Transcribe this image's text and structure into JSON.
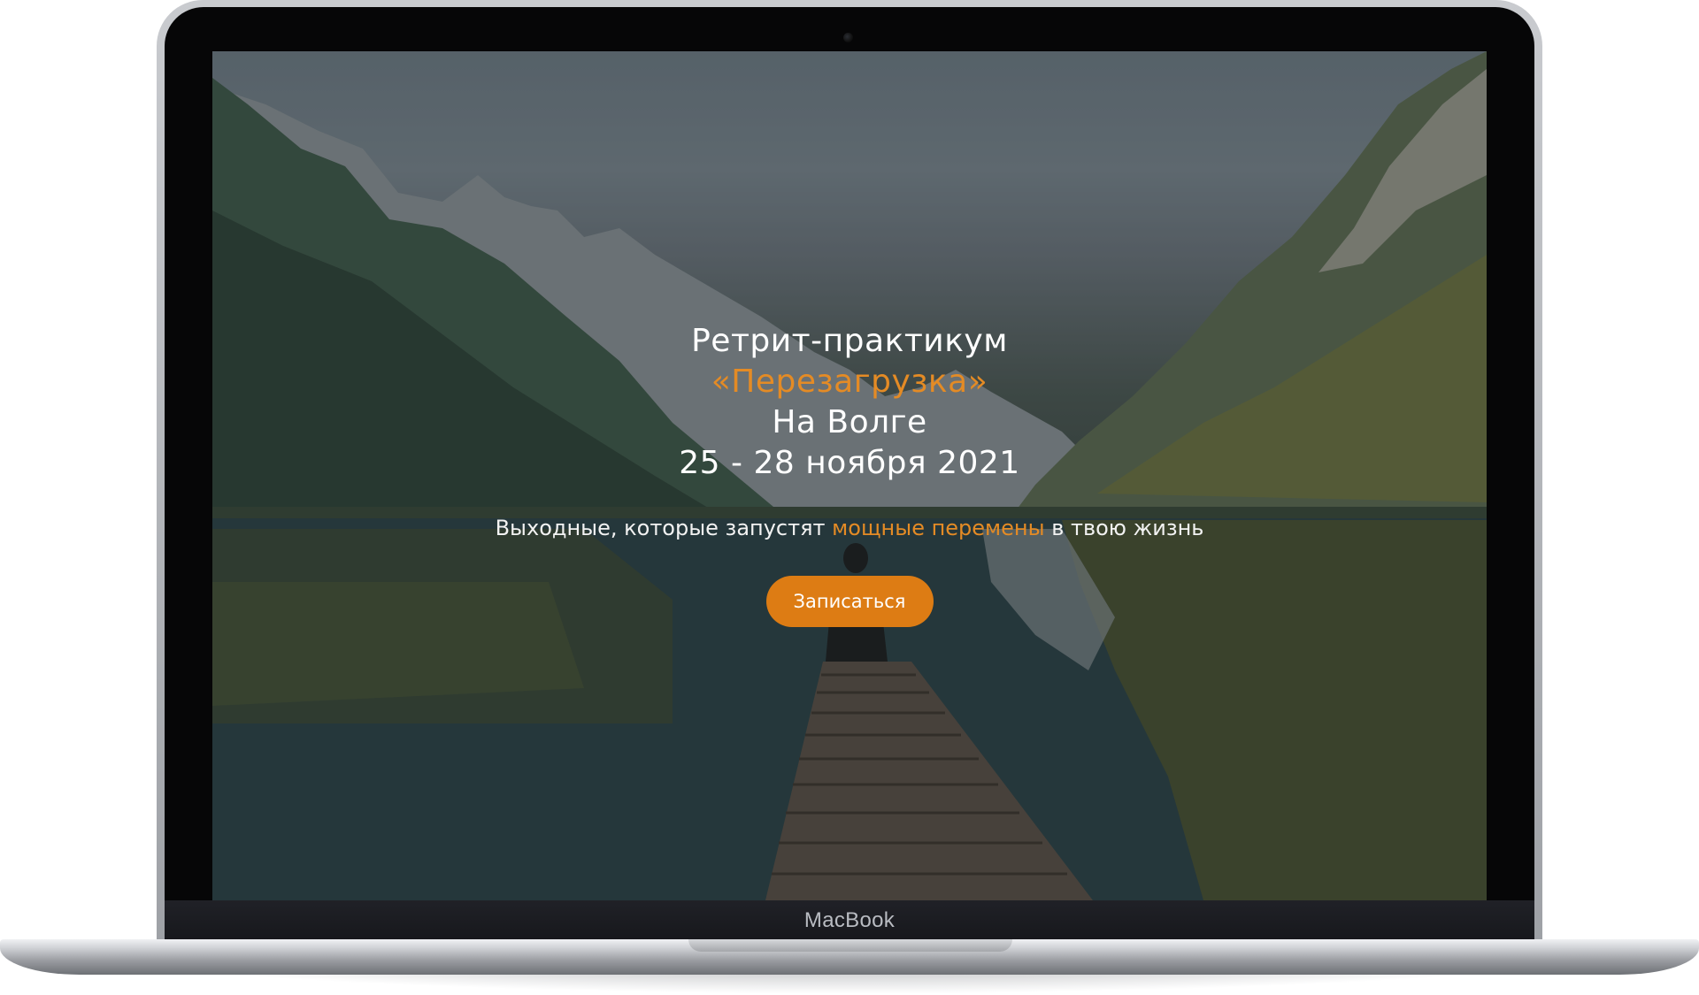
{
  "device": {
    "label": "MacBook"
  },
  "hero": {
    "title_line1": "Ретрит-практикум",
    "title_line2": "«Перезагрузка»",
    "title_line3": "На Волге",
    "title_line4": "25 - 28 ноября 2021",
    "subtitle_before": "Выходные, которые запустят ",
    "subtitle_highlight": "мощные перемены",
    "subtitle_after": " в твою жизнь",
    "cta_label": "Записаться"
  },
  "colors": {
    "accent": "#e48b25",
    "button": "#dd7c14",
    "text": "#ffffff"
  }
}
